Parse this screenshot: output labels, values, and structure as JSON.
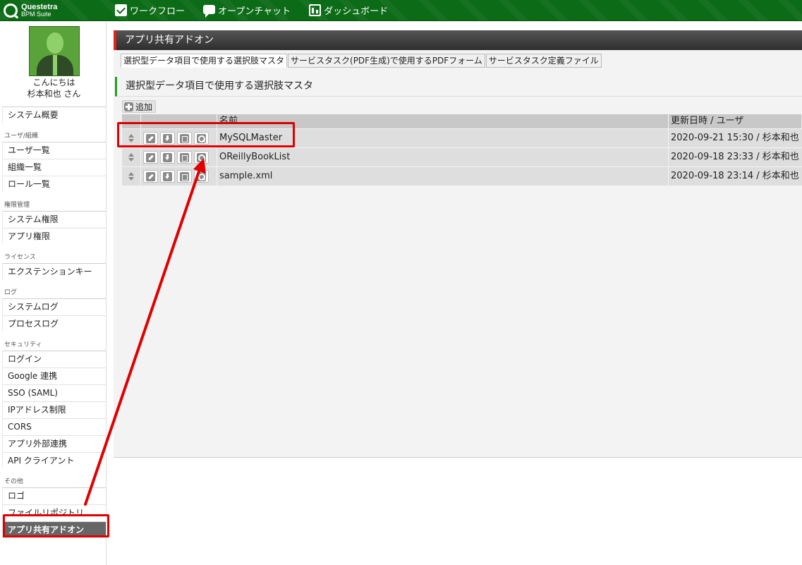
{
  "app": {
    "logo_line1": "Questetra",
    "logo_line2": "BPM Suite"
  },
  "topnav": [
    {
      "label": "ワークフロー",
      "icon": "check-icon"
    },
    {
      "label": "オープンチャット",
      "icon": "chat-icon"
    },
    {
      "label": "ダッシュボード",
      "icon": "dashboard-icon"
    }
  ],
  "profile": {
    "greeting": "こんにちは",
    "user": "杉本和也 さん"
  },
  "sidebar": {
    "system_overview": "システム概要",
    "sections": [
      {
        "title": "ユーザ/組織",
        "items": [
          "ユーザ一覧",
          "組織一覧",
          "ロール一覧"
        ]
      },
      {
        "title": "権限管理",
        "items": [
          "システム権限",
          "アプリ権限"
        ]
      },
      {
        "title": "ライセンス",
        "items": [
          "エクステンションキー"
        ]
      },
      {
        "title": "ログ",
        "items": [
          "システムログ",
          "プロセスログ"
        ]
      },
      {
        "title": "セキュリティ",
        "items": [
          "ログイン",
          "Google 連携",
          "SSO (SAML)",
          "IPアドレス制限",
          "CORS",
          "アプリ外部連携",
          "API クライアント"
        ]
      },
      {
        "title": "その他",
        "items": [
          "ロゴ",
          "ファイルリポジトリ",
          "アプリ共有アドオン"
        ]
      }
    ],
    "active_item": "アプリ共有アドオン"
  },
  "main": {
    "page_title": "アプリ共有アドオン",
    "tabs": [
      "選択型データ項目で使用する選択肢マスタ",
      "サービスタスク(PDF生成)で使用するPDFフォーム",
      "サービスタスク定義ファイル"
    ],
    "section_title": "選択型データ項目で使用する選択肢マスタ",
    "add_label": "追加",
    "table": {
      "headers": {
        "name": "名前",
        "updated": "更新日時 / ユーザ"
      },
      "rows": [
        {
          "name": "MySQLMaster",
          "updated": "2020-09-21 15:30 / 杉本和也"
        },
        {
          "name": "OReillyBookList",
          "updated": "2020-09-18 23:33 / 杉本和也"
        },
        {
          "name": "sample.xml",
          "updated": "2020-09-18 23:14 / 杉本和也"
        }
      ]
    }
  },
  "colors": {
    "topbar": "#0c6b17",
    "highlight": "#e00000",
    "active_menu": "#666666",
    "header_accent": "#e2221b"
  }
}
